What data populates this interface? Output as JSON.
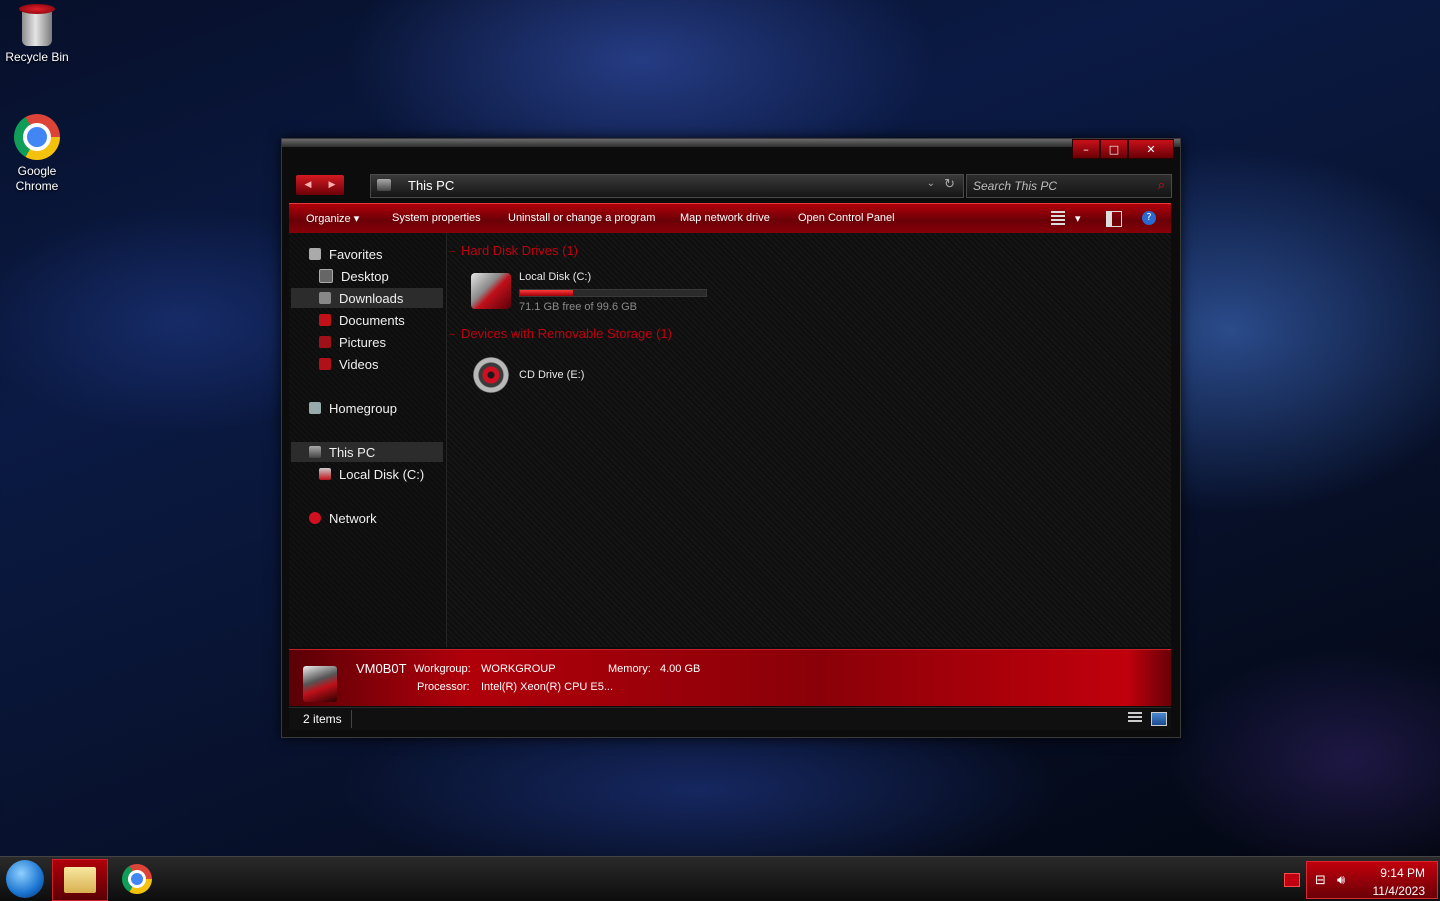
{
  "desktop": {
    "icons": [
      {
        "label": "Recycle Bin",
        "icon": "recycle-bin-icon"
      },
      {
        "label": "Google\nChrome",
        "icon": "chrome-icon"
      }
    ]
  },
  "window": {
    "title_buttons": {
      "minimize": "–",
      "maximize": "□",
      "close": "✕"
    },
    "nav": {
      "back": "◀",
      "forward": "▶"
    },
    "address": "This PC",
    "address_dropdown": "⌄",
    "refresh": "↻",
    "search_placeholder": "Search This PC",
    "search_icon": "⌕",
    "toolbar": {
      "organize": "Organize ▾",
      "system_properties": "System properties",
      "uninstall": "Uninstall or change a program",
      "map_drive": "Map network drive",
      "control_panel": "Open Control Panel",
      "view_dropdown": "▾",
      "help": "?"
    },
    "nav_pane": {
      "favorites": "Favorites",
      "desktop": "Desktop",
      "downloads": "Downloads",
      "documents": "Documents",
      "pictures": "Pictures",
      "videos": "Videos",
      "homegroup": "Homegroup",
      "this_pc": "This PC",
      "local_disk": "Local Disk (C:)",
      "network": "Network"
    },
    "groups": {
      "hard_disks": "Hard Disk Drives (1)",
      "removable": "Devices with Removable Storage (1)"
    },
    "drives": {
      "c_name": "Local Disk (C:)",
      "c_free": "71.1 GB free of 99.6 GB",
      "c_used_fraction": 0.286,
      "e_name": "CD Drive (E:)"
    },
    "details": {
      "computer_name": "VM0B0T",
      "workgroup_label": "Workgroup:",
      "workgroup_value": "WORKGROUP",
      "memory_label": "Memory:",
      "memory_value": "4.00 GB",
      "processor_label": "Processor:",
      "processor_value": "Intel(R) Xeon(R) CPU E5..."
    },
    "status": {
      "items": "2 items"
    }
  },
  "taskbar": {
    "time": "9:14 PM",
    "date": "11/4/2023"
  },
  "colors": {
    "accent_red": "#b0000a",
    "group_header_red": "#c00010"
  }
}
